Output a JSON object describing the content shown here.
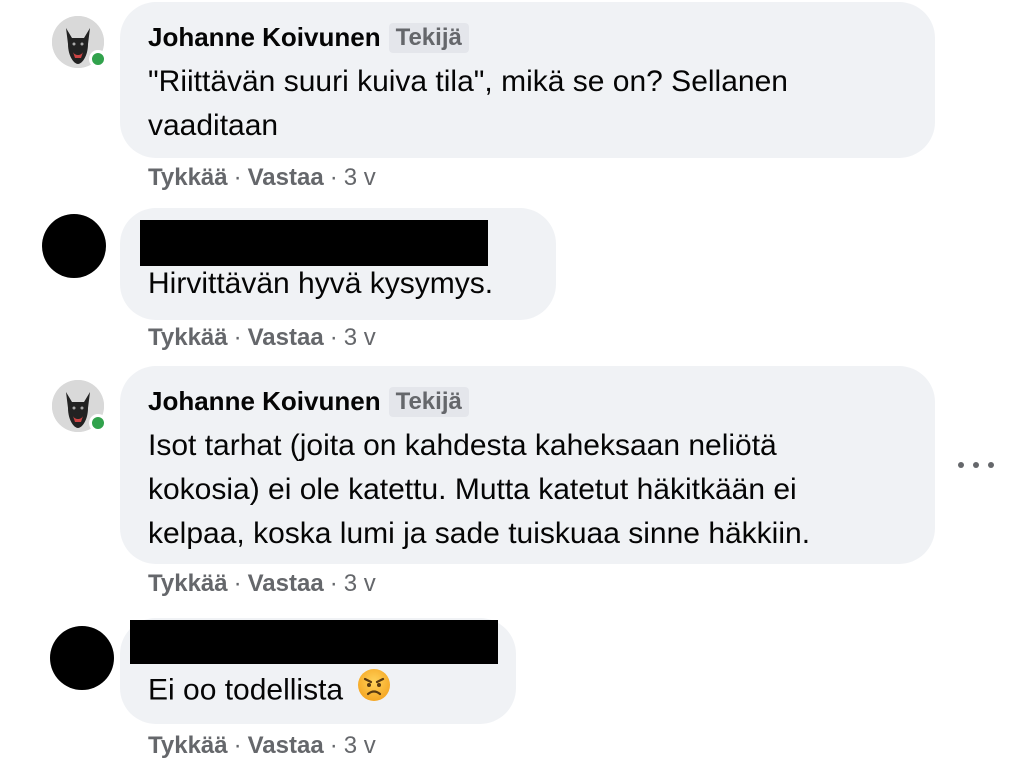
{
  "comments": [
    {
      "author": "Johanne Koivunen",
      "badge": "Tekijä",
      "lines": [
        "\"Riittävän suuri kuiva tila\", mikä se on? Sellanen",
        "vaaditaan"
      ],
      "like": "Tykkää",
      "reply": "Vastaa",
      "dot": "·",
      "time": "3 v"
    },
    {
      "author": "",
      "lines": [
        "Hirvittävän hyvä kysymys."
      ],
      "like": "Tykkää",
      "reply": "Vastaa",
      "dot": "·",
      "time": "3 v"
    },
    {
      "author": "Johanne Koivunen",
      "badge": "Tekijä",
      "lines": [
        "Isot tarhat (joita on kahdesta kaheksaan neliötä",
        "kokosia) ei ole katettu. Mutta katetut häkitkään ei",
        "kelpaa, koska lumi ja sade tuiskuaa sinne häkkiin."
      ],
      "like": "Tykkää",
      "reply": "Vastaa",
      "dot": "·",
      "time": "3 v"
    },
    {
      "author": "",
      "lines": [
        "Ei oo todellista"
      ],
      "emoji": "angry-face-icon",
      "like": "Tykkää",
      "reply": "Vastaa",
      "dot": "·",
      "time": "3 v"
    }
  ],
  "colors": {
    "bubble": "#f0f2f5",
    "online": "#31a24c",
    "meta": "#65676b",
    "text": "#050505"
  },
  "icons": {
    "more": "more-options-icon",
    "status": "online-status-icon"
  }
}
